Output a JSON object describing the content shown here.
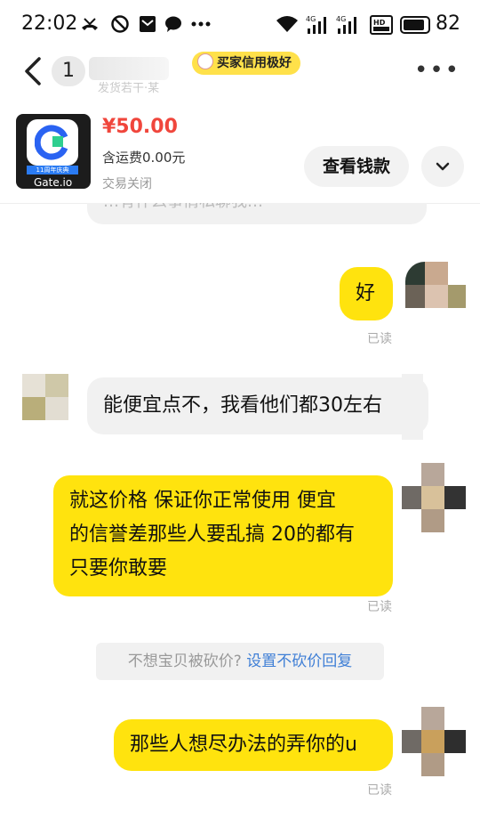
{
  "status_bar": {
    "time": "22:02",
    "battery": "82",
    "icons": [
      "missed-call-icon",
      "do-not-disturb-icon",
      "mail-icon",
      "message-icon",
      "more-notifications-icon",
      "wifi-icon",
      "signal-4g-icon",
      "signal-4g-icon",
      "hd-icon",
      "battery-icon"
    ]
  },
  "header": {
    "unread_count": "1",
    "subtitle": "发货若干·某",
    "credit_badge": "买家信用极好",
    "more_label": "•••"
  },
  "product": {
    "price": "¥50.00",
    "shipping": "含运费0.00元",
    "status": "交易关闭",
    "view_button": "查看钱款",
    "thumb_band": "11周年庆典",
    "thumb_brand": "Gate.io"
  },
  "messages": [
    {
      "side": "in",
      "text": "…有什么事情私聊我…",
      "cut": true
    },
    {
      "side": "out",
      "text": "好",
      "read": "已读"
    },
    {
      "side": "in",
      "text": "能便宜点不，我看他们都30左右"
    },
    {
      "side": "out",
      "lines": [
        "就这价格 保证你正常使用 便宜",
        "的信誉差那些人要乱搞 20的都有",
        "只要你敢要"
      ],
      "read": "已读"
    },
    {
      "side": "out",
      "text": "那些人想尽办法的弄你的u",
      "read": "已读"
    }
  ],
  "notice": {
    "text": "不想宝贝被砍价? ",
    "link": "设置不砍价回复"
  },
  "colors": {
    "accent_yellow": "#ffe30e",
    "price_red": "#f0463c",
    "link_blue": "#3f7fd6",
    "incoming_bubble": "#f1f1f1"
  }
}
